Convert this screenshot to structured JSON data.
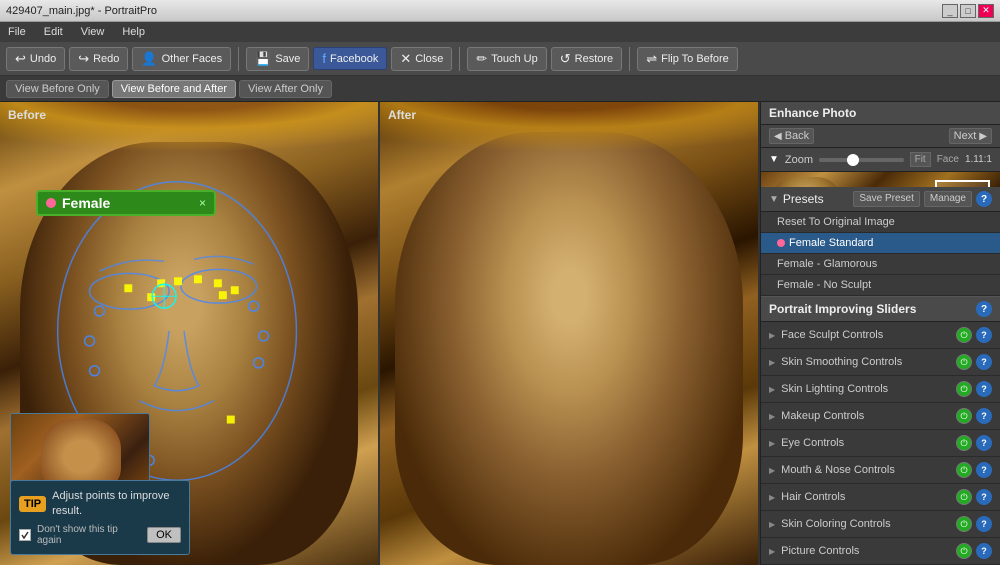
{
  "window": {
    "title": "429407_main.jpg* - PortraitPro"
  },
  "menu": {
    "items": [
      "File",
      "Edit",
      "View",
      "Help"
    ]
  },
  "toolbar": {
    "undo": "Undo",
    "redo": "Redo",
    "other_faces": "Other Faces",
    "save": "Save",
    "facebook": "Facebook",
    "close": "Close",
    "touch_up": "Touch Up",
    "restore": "Restore",
    "flip_to_before": "Flip To Before"
  },
  "view_buttons": {
    "before_only": "View Before Only",
    "before_after": "View Before and After",
    "after_only": "View After Only"
  },
  "panels": {
    "before_label": "Before",
    "after_label": "After"
  },
  "gender_box": {
    "label": "Female",
    "close": "×"
  },
  "tip": {
    "badge": "TIP",
    "text": "Adjust points to improve result.",
    "checkbox_label": "Don't show this tip again",
    "ok_button": "OK"
  },
  "right_panel": {
    "enhance_title": "Enhance Photo",
    "back_label": "Back",
    "next_label": "Next",
    "zoom_label": "Zoom",
    "zoom_fit": "Fit",
    "zoom_face": "Face",
    "zoom_value": "1.11:1",
    "presets_title": "Presets",
    "save_preset": "Save Preset",
    "manage": "Manage",
    "help": "?",
    "presets": [
      {
        "label": "Reset To Original Image",
        "selected": false,
        "has_dot": false
      },
      {
        "label": "Female Standard",
        "selected": true,
        "has_dot": true
      },
      {
        "label": "Female - Glamorous",
        "selected": false,
        "has_dot": false
      },
      {
        "label": "Female - No Sculpt",
        "selected": false,
        "has_dot": false
      }
    ],
    "sliders_title": "Portrait Improving Sliders",
    "slider_items": [
      {
        "label": "Face Sculpt Controls",
        "id": "face-sculpt"
      },
      {
        "label": "Skin Smoothing Controls",
        "id": "skin-smoothing"
      },
      {
        "label": "Skin Lighting Controls",
        "id": "skin-lighting"
      },
      {
        "label": "Makeup Controls",
        "id": "makeup"
      },
      {
        "label": "Eye Controls",
        "id": "eye"
      },
      {
        "label": "Mouth & Nose Controls",
        "id": "mouth-nose"
      },
      {
        "label": "Hair Controls",
        "id": "hair"
      },
      {
        "label": "Skin Coloring Controls",
        "id": "skin-coloring"
      },
      {
        "label": "Picture Controls",
        "id": "picture"
      }
    ]
  }
}
